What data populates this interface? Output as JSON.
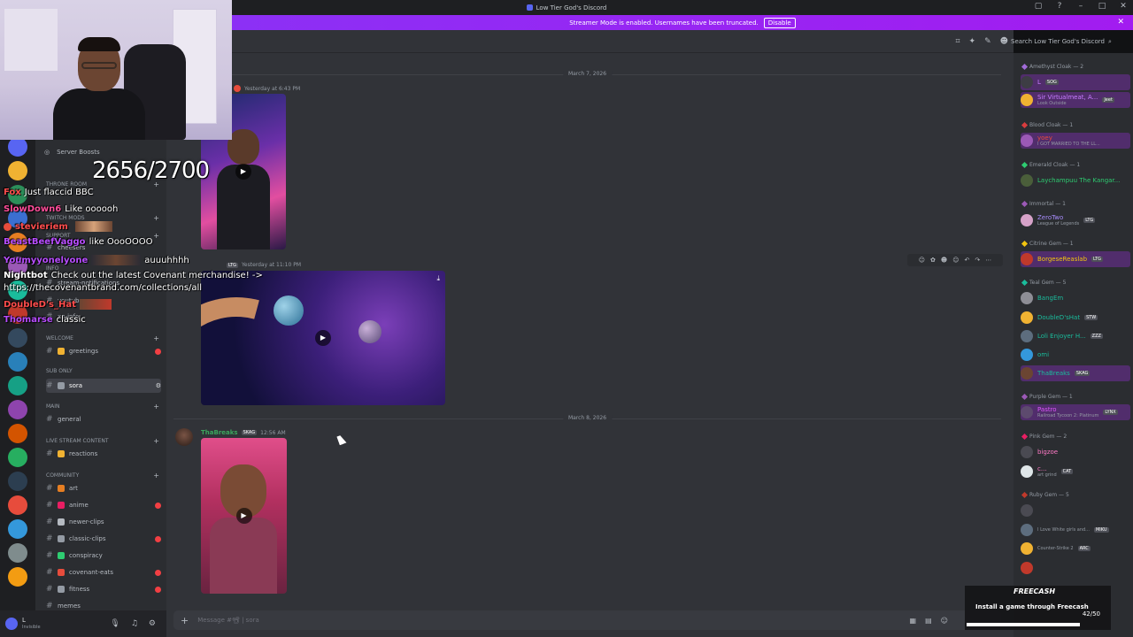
{
  "window": {
    "title": "Low Tier God's Discord"
  },
  "banner": {
    "text": "Streamer Mode is enabled. Usernames have been truncated.",
    "button": "Disable"
  },
  "header": {
    "search_placeholder": "Search Low Tier God's Discord"
  },
  "sidebar": {
    "boosts_label": "Server Boosts",
    "categories": [
      {
        "label": "THRONE ROOM"
      },
      {
        "label": "TWITCH MODS"
      },
      {
        "label": "SUPPORT"
      },
      {
        "label": "INFO"
      },
      {
        "label": "WELCOME"
      },
      {
        "label": "SUB ONLY"
      },
      {
        "label": "MAIN"
      },
      {
        "label": "LIVE STREAM CONTENT"
      },
      {
        "label": "COMMUNITY"
      }
    ],
    "channels": [
      {
        "label": "cheesers"
      },
      {
        "label": "stream-notifications"
      },
      {
        "label": "youtube"
      },
      {
        "label": "xp-info"
      },
      {
        "label": "greetings"
      },
      {
        "label": "sora"
      },
      {
        "label": "general"
      },
      {
        "label": "reactions"
      },
      {
        "label": "art"
      },
      {
        "label": "anime"
      },
      {
        "label": "newer-clips"
      },
      {
        "label": "classic-clips"
      },
      {
        "label": "conspiracy"
      },
      {
        "label": "covenant-eats"
      },
      {
        "label": "fitness"
      },
      {
        "label": "memes"
      }
    ]
  },
  "user": {
    "status": "Invisible",
    "name": "L"
  },
  "chat": {
    "dates": [
      "March 7, 2026",
      "March 8, 2026"
    ],
    "messages": [
      {
        "time": "Yesterday at 6:43 PM"
      },
      {
        "tag": "LTG",
        "time": "Yesterday at 11:10 PM"
      },
      {
        "author": "ThaBreaks",
        "tag": "SKAG",
        "time": "12:56 AM"
      }
    ],
    "composer_placeholder": "Message #📽 | sora"
  },
  "members": {
    "groups": [
      {
        "label": "Amethyst Cloak — 2",
        "color": "#a16bd8"
      },
      {
        "label": "Blood Cloak — 1",
        "color": "#d83c3e"
      },
      {
        "label": "Emerald Cloak — 1",
        "color": "#2ecc71"
      },
      {
        "label": "Immortal — 1",
        "color": "#9b59b6"
      },
      {
        "label": "Citrine Gem — 1",
        "color": "#f1c40f"
      },
      {
        "label": "Teal Gem — 5",
        "color": "#1abc9c"
      },
      {
        "label": "Purple Gem — 1",
        "color": "#9b59b6"
      },
      {
        "label": "Pink Gem — 2",
        "color": "#e91e63"
      },
      {
        "label": "Ruby Gem — 5",
        "color": "#c0392b"
      }
    ],
    "items": [
      {
        "name": "L",
        "tag": "SOG",
        "status": "",
        "color": "#c77dff"
      },
      {
        "name": "Sir Virtualmeat, A...",
        "tag": "Jeet",
        "status": "Look Outside",
        "color": "#c77dff"
      },
      {
        "name": "yoey",
        "tag": "",
        "status": "I GOT MARRIED TO THE LL...",
        "color": "#e74c3c"
      },
      {
        "name": "Laychampuu The Kangar...",
        "tag": "",
        "status": "",
        "color": "#2ecc71"
      },
      {
        "name": "ZeroTwo",
        "tag": "LTG",
        "status": "League of Legends",
        "color": "#a78bfa"
      },
      {
        "name": "BorgeseReaslab",
        "tag": "LTG",
        "status": "",
        "color": "#f1c40f"
      },
      {
        "name": "BangEm",
        "tag": "",
        "status": "",
        "color": "#1abc9c"
      },
      {
        "name": "DoubleD'sHat",
        "tag": "STW",
        "status": "",
        "color": "#1abc9c"
      },
      {
        "name": "Loli Enjoyer H...",
        "tag": "ZZZ",
        "status": "",
        "color": "#1abc9c"
      },
      {
        "name": "omi",
        "tag": "",
        "status": "",
        "color": "#1abc9c"
      },
      {
        "name": "ThaBreaks",
        "tag": "SKAG",
        "status": "",
        "color": "#1abc9c"
      },
      {
        "name": "Pastro",
        "tag": "LYNX",
        "status": "Railroad Tycoon 2: Platinum",
        "color": "#e056fd"
      },
      {
        "name": "bigzoe",
        "tag": "",
        "status": "",
        "color": "#ff79c6"
      },
      {
        "name": "c...",
        "tag": "CAT",
        "status": "art grind",
        "color": "#ff79c6"
      },
      {
        "name": "",
        "tag": "",
        "status": "",
        "color": "#e74c3c"
      },
      {
        "name": "",
        "tag": "MIKU",
        "status": "I Love White girls and...",
        "color": "#e74c3c"
      },
      {
        "name": "",
        "tag": "ARC",
        "status": "Counter-Strike 2",
        "color": "#e74c3c"
      },
      {
        "name": "",
        "tag": "",
        "status": "",
        "color": "#e74c3c"
      }
    ]
  },
  "overlay": {
    "counter": "2656/2700",
    "chat": [
      {
        "user": "Fox",
        "text": "Just flaccid BBC",
        "color": "#ff4d4d"
      },
      {
        "user": "SlowDown6",
        "text": "Like oooooh",
        "color": "#ff4d9a"
      },
      {
        "user": "stevieriem",
        "text": "",
        "color": "#ff4d4d"
      },
      {
        "user": "BeastBeefVaggo",
        "text": "like OooOOOO",
        "color": "#b84dff"
      },
      {
        "user": "Youmyyonelyone",
        "text": "auuuhhhh",
        "color": "#b84dff"
      },
      {
        "user": "Nightbot",
        "text": "Check out the latest Covenant merchandise! ->",
        "color": "#ffffff"
      },
      {
        "user": "",
        "text": "https://thecovenantbrand.com/collections/all",
        "color": "#ffffff"
      },
      {
        "user": "DoubleD's_Hat",
        "text": "",
        "color": "#ff4d4d"
      },
      {
        "user": "Thomarse",
        "text": "classic",
        "color": "#b84dff"
      }
    ]
  },
  "promo": {
    "brand": "FREECASH",
    "text": "Install a game through Freecash",
    "count": "42/50"
  }
}
